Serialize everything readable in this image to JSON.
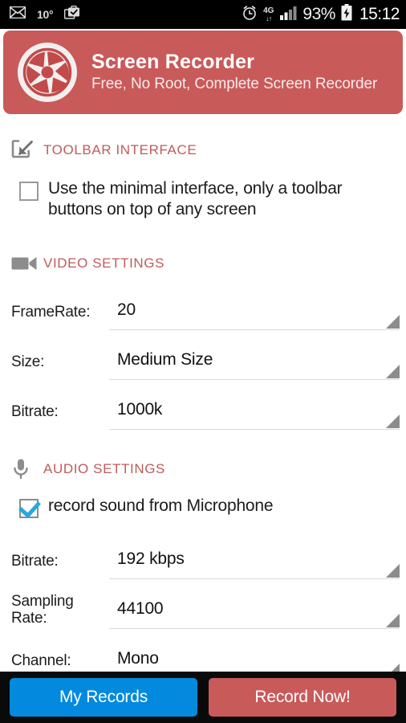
{
  "status_bar": {
    "left_icons": [
      {
        "name": "mail-icon",
        "glyph": "envelope"
      },
      {
        "name": "temperature-indicator",
        "text": "10°"
      },
      {
        "name": "work-profile-icon",
        "glyph": "briefcase-check"
      }
    ],
    "temperature": "10°",
    "alarm_icon": "alarm-clock-icon",
    "network": {
      "label": "4G",
      "arrows": "↓↑"
    },
    "signal_icon": "signal-bars-icon",
    "battery_percent": "93%",
    "battery_icon": "battery-charging-icon",
    "time": "15:12"
  },
  "header": {
    "logo": "camera-aperture-logo",
    "title": "Screen Recorder",
    "subtitle": "Free, No Root, Complete Screen Recorder",
    "background_color": "#c95a5a"
  },
  "sections": {
    "toolbar": {
      "icon": "minimize-arrow-icon",
      "title": "TOOLBAR INTERFACE",
      "checkbox": {
        "label": "Use the minimal interface, only a toolbar buttons on top of any screen",
        "checked": false
      }
    },
    "video": {
      "icon": "video-camera-icon",
      "title": "VIDEO SETTINGS",
      "rows": [
        {
          "label": "FrameRate:",
          "value": "20"
        },
        {
          "label": "Size:",
          "value": "Medium Size"
        },
        {
          "label": "Bitrate:",
          "value": "1000k"
        }
      ]
    },
    "audio": {
      "icon": "microphone-icon",
      "title": "AUDIO SETTINGS",
      "checkbox": {
        "label": "record sound from Microphone",
        "checked": true
      },
      "rows": [
        {
          "label": "Bitrate:",
          "value": "192 kbps"
        },
        {
          "label": "Sampling Rate:",
          "value": "44100"
        },
        {
          "label": "Channel:",
          "value": "Mono"
        }
      ]
    }
  },
  "bottom_bar": {
    "my_records_label": "My Records",
    "record_now_label": "Record Now!",
    "my_records_color": "#038ade",
    "record_now_color": "#c95a5a"
  },
  "colors": {
    "section_title": "#c05b5b",
    "checkbox_check": "#29a8dc",
    "icon_gray": "#8c8c8c"
  }
}
